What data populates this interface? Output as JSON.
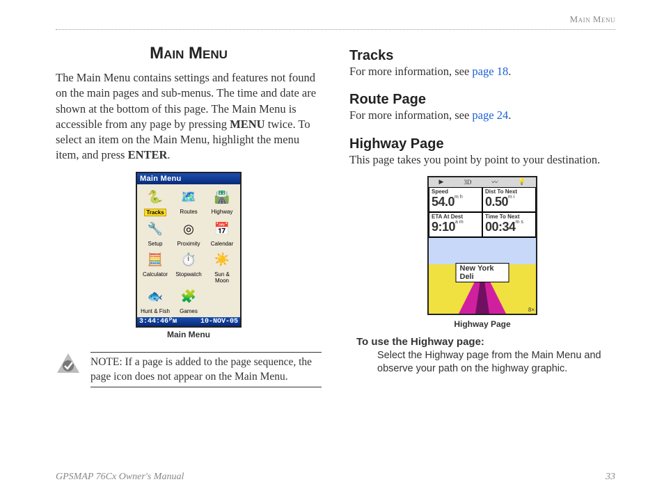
{
  "header": {
    "section": "Main Menu"
  },
  "left": {
    "title": "Main Menu",
    "intro_pre": "The Main Menu contains settings and features not found on the main pages and sub-menus. The time and date are shown at the bottom of this page. The Main Menu is accessible from any page by pressing ",
    "intro_bold1": "MENU",
    "intro_mid": " twice. To select an item on the Main Menu, highlight the menu item, and press ",
    "intro_bold2": "ENTER",
    "intro_end": ".",
    "device": {
      "titlebar": "Main Menu",
      "items": [
        {
          "label": "Tracks",
          "glyph": "🐍",
          "selected": true
        },
        {
          "label": "Routes",
          "glyph": "🗺️",
          "selected": false
        },
        {
          "label": "Highway",
          "glyph": "🛣️",
          "selected": false
        },
        {
          "label": "Setup",
          "glyph": "🔧",
          "selected": false
        },
        {
          "label": "Proximity",
          "glyph": "◎",
          "selected": false
        },
        {
          "label": "Calendar",
          "glyph": "📅",
          "selected": false
        },
        {
          "label": "Calculator",
          "glyph": "🧮",
          "selected": false
        },
        {
          "label": "Stopwatch",
          "glyph": "⏱️",
          "selected": false
        },
        {
          "label": "Sun & Moon",
          "glyph": "☀️",
          "selected": false
        },
        {
          "label": "Hunt & Fish",
          "glyph": "🐟",
          "selected": false
        },
        {
          "label": "Games",
          "glyph": "🧩",
          "selected": false
        }
      ],
      "status_time": "3:44:46ᴾᴍ",
      "status_date": "10-NOV-05"
    },
    "caption": "Main Menu",
    "note_label": "NOTE:",
    "note_text": " If a page is added to the page sequence, the page icon does not appear on the Main Menu."
  },
  "right": {
    "tracks_h": "Tracks",
    "tracks_pre": "For more information, see ",
    "tracks_link": "page 18",
    "route_h": "Route Page",
    "route_pre": "For more information, see ",
    "route_link": "page 24",
    "highway_h": "Highway Page",
    "highway_body": "This page takes you point by point to your destination.",
    "hw_device": {
      "fields": [
        {
          "label": "Speed",
          "value": "54.0",
          "unit": "m h"
        },
        {
          "label": "Dist To Next",
          "value": "0.50",
          "unit": "m i"
        },
        {
          "label": "ETA At Dest",
          "value": "9:10",
          "unit": "a m"
        },
        {
          "label": "Time To Next",
          "value": "00:34",
          "unit": "m s"
        }
      ],
      "sign": "New York Deli",
      "zoom": "8×"
    },
    "hw_caption": "Highway Page",
    "instr_head": "To use the Highway page:",
    "instr_body": "Select the Highway page from the Main Menu and observe your path on the highway graphic."
  },
  "footer": {
    "left": "GPSMAP 76Cx Owner's Manual",
    "right": "33"
  }
}
